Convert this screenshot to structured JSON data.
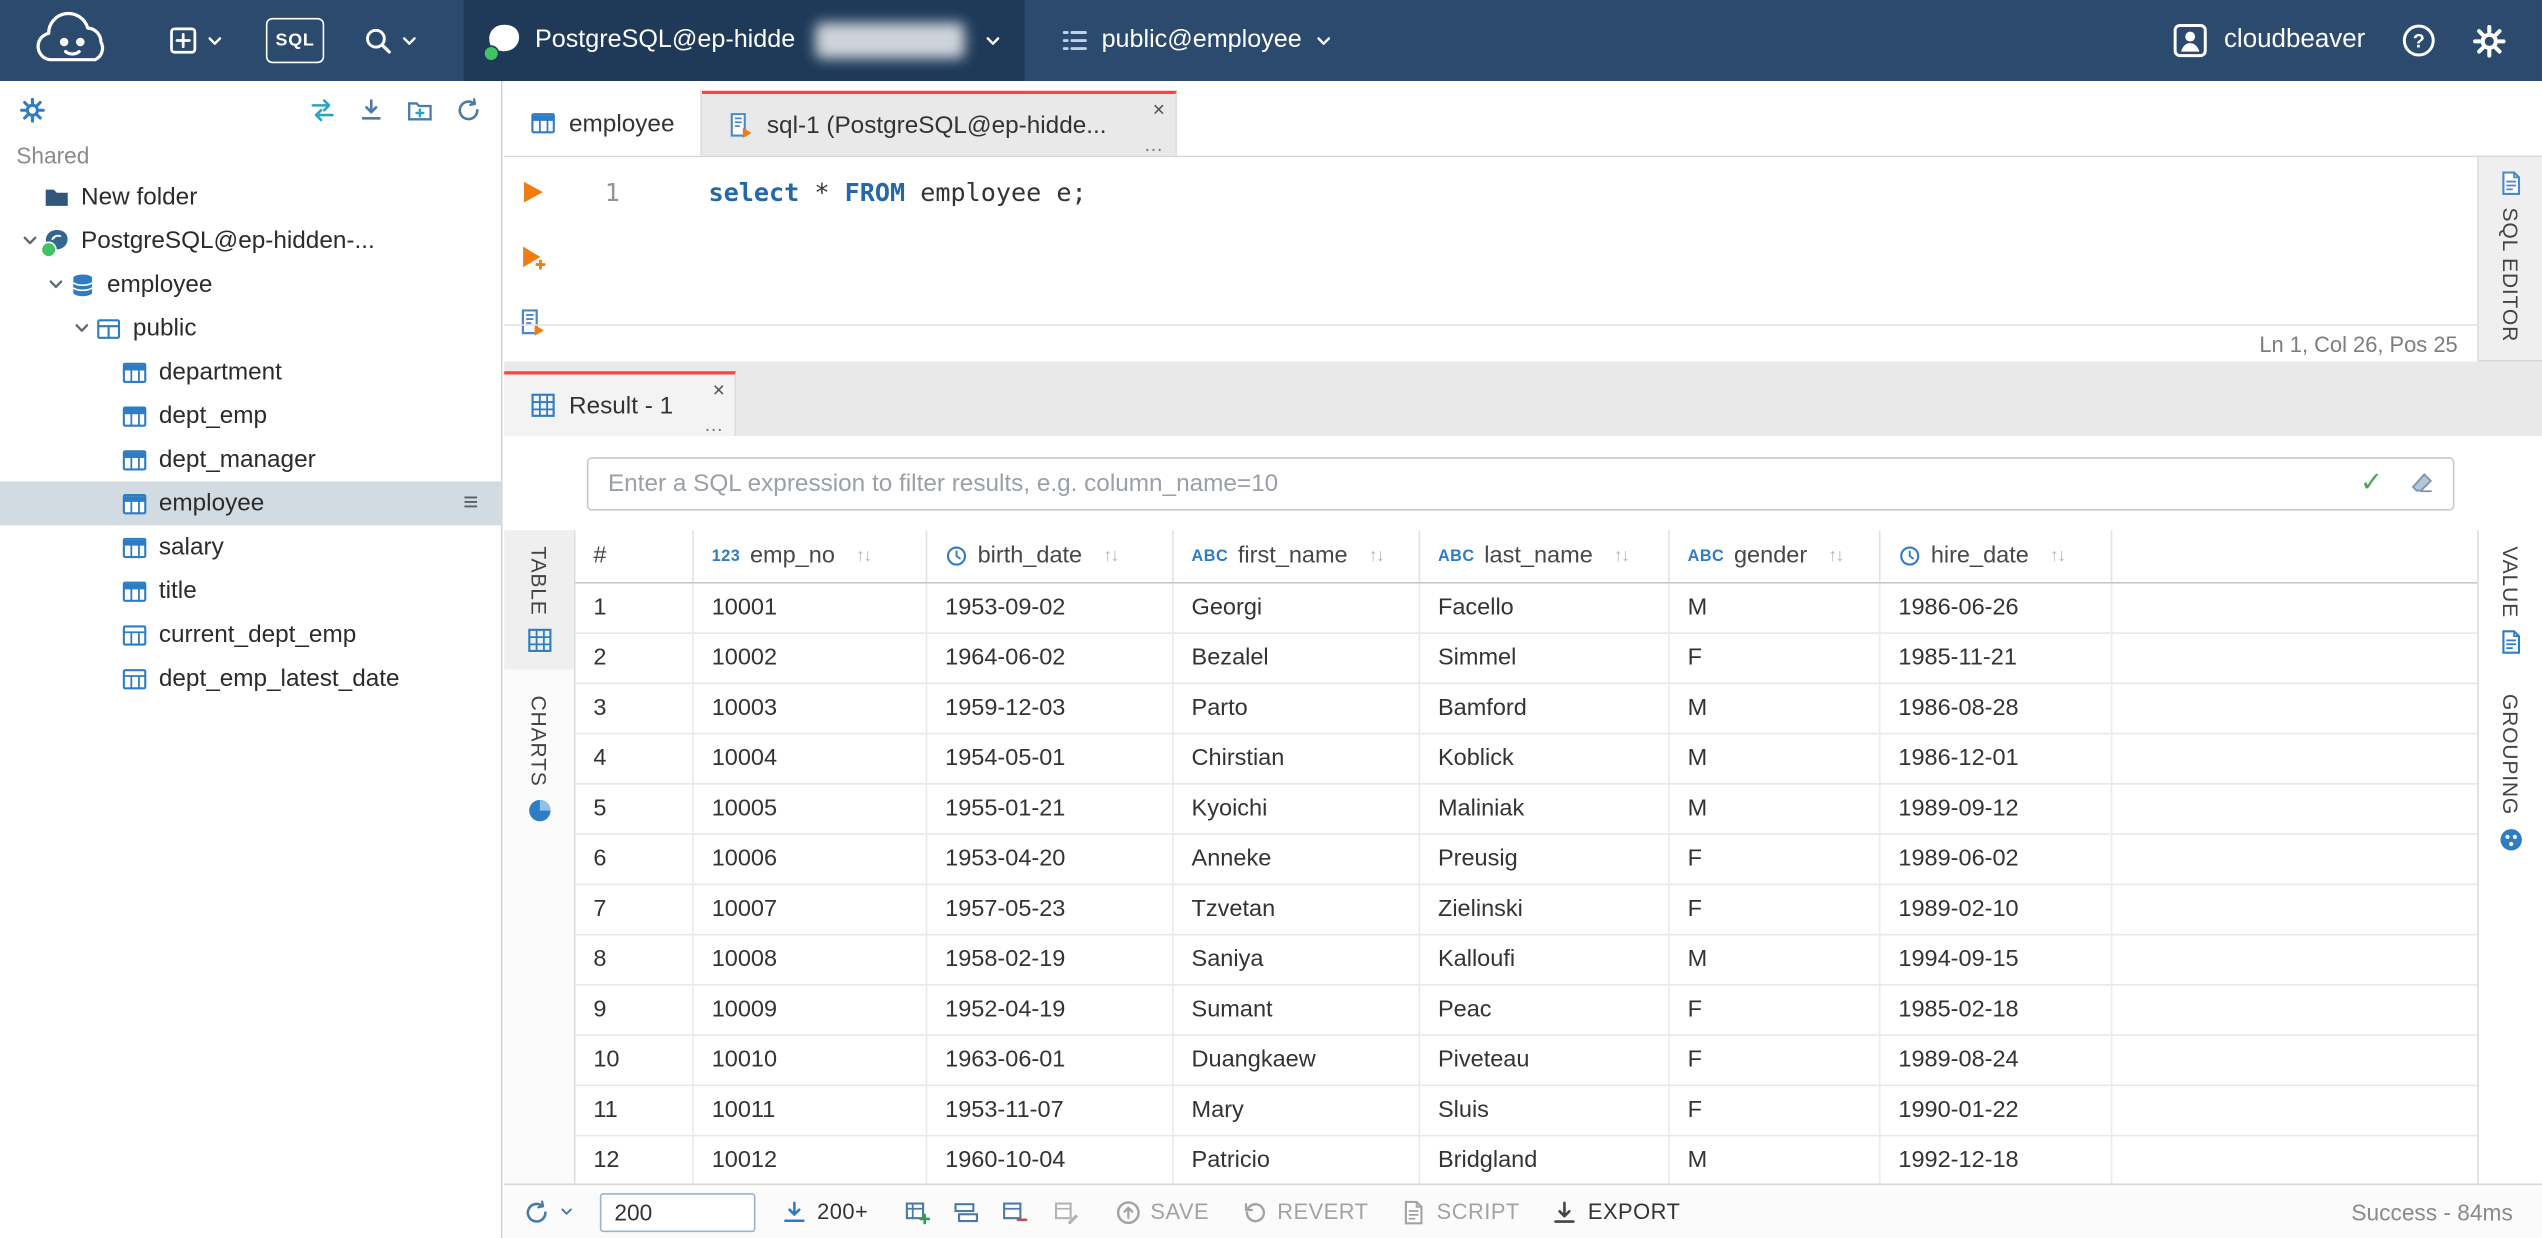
{
  "topbar": {
    "sql_badge": "SQL",
    "connection_label": "PostgreSQL@ep-hidde",
    "schema_label": "public@employee",
    "user_label": "cloudbeaver"
  },
  "sidebar": {
    "section_label": "Shared",
    "tree": [
      {
        "label": "New folder",
        "icon": "folder"
      },
      {
        "label": "PostgreSQL@ep-hidden-...",
        "icon": "postgres"
      },
      {
        "label": "employee",
        "icon": "database"
      },
      {
        "label": "public",
        "icon": "schema"
      },
      {
        "label": "department",
        "icon": "table"
      },
      {
        "label": "dept_emp",
        "icon": "table"
      },
      {
        "label": "dept_manager",
        "icon": "table"
      },
      {
        "label": "employee",
        "icon": "table",
        "selected": true
      },
      {
        "label": "salary",
        "icon": "table"
      },
      {
        "label": "title",
        "icon": "table"
      },
      {
        "label": "current_dept_emp",
        "icon": "view"
      },
      {
        "label": "dept_emp_latest_date",
        "icon": "view"
      }
    ]
  },
  "editor": {
    "tabs": [
      {
        "label": "employee"
      },
      {
        "label": "sql-1 (PostgreSQL@ep-hidde..."
      }
    ],
    "line_number": "1",
    "code": {
      "kw1": "select",
      "op": " * ",
      "kw2": "FROM",
      "rest": " employee e;"
    },
    "status": "Ln 1, Col 26, Pos 25",
    "side_label": "SQL EDITOR"
  },
  "result": {
    "tab_label": "Result - 1",
    "filter_placeholder": "Enter a SQL expression to filter results, e.g. column_name=10",
    "left_tabs": {
      "table": "TABLE",
      "charts": "CHARTS"
    },
    "right_tabs": {
      "value": "VALUE",
      "grouping": "GROUPING"
    }
  },
  "grid": {
    "row_header": "#",
    "sort_glyph": "↑↓",
    "columns": [
      {
        "badge": "123",
        "label": "emp_no"
      },
      {
        "icon": "clock",
        "label": "birth_date"
      },
      {
        "badge": "ABC",
        "label": "first_name"
      },
      {
        "badge": "ABC",
        "label": "last_name"
      },
      {
        "badge": "ABC",
        "label": "gender"
      },
      {
        "icon": "clock",
        "label": "hire_date"
      }
    ],
    "rows": [
      {
        "n": "1",
        "emp_no": "10001",
        "birth_date": "1953-09-02",
        "first_name": "Georgi",
        "last_name": "Facello",
        "gender": "M",
        "hire_date": "1986-06-26"
      },
      {
        "n": "2",
        "emp_no": "10002",
        "birth_date": "1964-06-02",
        "first_name": "Bezalel",
        "last_name": "Simmel",
        "gender": "F",
        "hire_date": "1985-11-21"
      },
      {
        "n": "3",
        "emp_no": "10003",
        "birth_date": "1959-12-03",
        "first_name": "Parto",
        "last_name": "Bamford",
        "gender": "M",
        "hire_date": "1986-08-28"
      },
      {
        "n": "4",
        "emp_no": "10004",
        "birth_date": "1954-05-01",
        "first_name": "Chirstian",
        "last_name": "Koblick",
        "gender": "M",
        "hire_date": "1986-12-01"
      },
      {
        "n": "5",
        "emp_no": "10005",
        "birth_date": "1955-01-21",
        "first_name": "Kyoichi",
        "last_name": "Maliniak",
        "gender": "M",
        "hire_date": "1989-09-12"
      },
      {
        "n": "6",
        "emp_no": "10006",
        "birth_date": "1953-04-20",
        "first_name": "Anneke",
        "last_name": "Preusig",
        "gender": "F",
        "hire_date": "1989-06-02"
      },
      {
        "n": "7",
        "emp_no": "10007",
        "birth_date": "1957-05-23",
        "first_name": "Tzvetan",
        "last_name": "Zielinski",
        "gender": "F",
        "hire_date": "1989-02-10"
      },
      {
        "n": "8",
        "emp_no": "10008",
        "birth_date": "1958-02-19",
        "first_name": "Saniya",
        "last_name": "Kalloufi",
        "gender": "M",
        "hire_date": "1994-09-15"
      },
      {
        "n": "9",
        "emp_no": "10009",
        "birth_date": "1952-04-19",
        "first_name": "Sumant",
        "last_name": "Peac",
        "gender": "F",
        "hire_date": "1985-02-18"
      },
      {
        "n": "10",
        "emp_no": "10010",
        "birth_date": "1963-06-01",
        "first_name": "Duangkaew",
        "last_name": "Piveteau",
        "gender": "F",
        "hire_date": "1989-08-24"
      },
      {
        "n": "11",
        "emp_no": "10011",
        "birth_date": "1953-11-07",
        "first_name": "Mary",
        "last_name": "Sluis",
        "gender": "F",
        "hire_date": "1990-01-22"
      },
      {
        "n": "12",
        "emp_no": "10012",
        "birth_date": "1960-10-04",
        "first_name": "Patricio",
        "last_name": "Bridgland",
        "gender": "M",
        "hire_date": "1992-12-18"
      }
    ]
  },
  "statusbar": {
    "page_size_value": "200",
    "fetch_label": "200+",
    "save_label": "SAVE",
    "revert_label": "REVERT",
    "script_label": "SCRIPT",
    "export_label": "EXPORT",
    "status_text": "Success - 84ms"
  },
  "icons": {
    "close": "×",
    "more": "…",
    "menu": "≡"
  }
}
